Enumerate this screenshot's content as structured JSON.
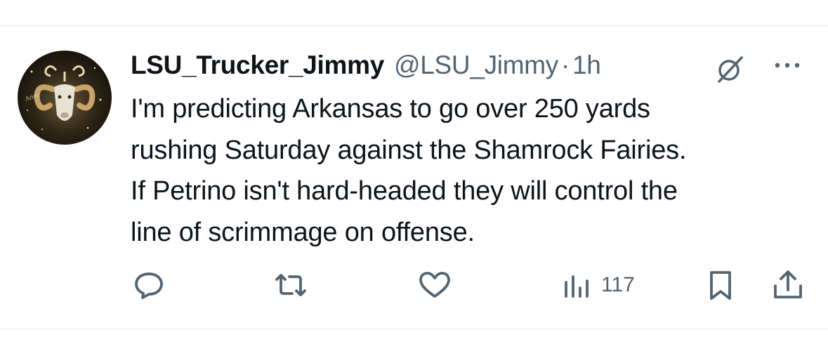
{
  "tweet": {
    "display_name": "LSU_Trucker_Jimmy",
    "handle": "@LSU_Jimmy",
    "separator": "·",
    "time": "1h",
    "avatar_icon": "aries-ram-avatar",
    "text_lines": [
      "I'm predicting Arkansas to go over 250 yards",
      "rushing Saturday against the Shamrock Fairies.",
      "If Petrino isn't hard-headed they will control the",
      "line of scrimmage on offense."
    ]
  },
  "actions": {
    "reply_icon": "reply-icon",
    "retweet_icon": "retweet-icon",
    "like_icon": "heart-icon",
    "views_icon": "views-bar-chart-icon",
    "views_count": "117",
    "bookmark_icon": "bookmark-icon",
    "share_icon": "share-icon"
  },
  "header_icons": {
    "grok": "grok-icon",
    "more": "more-icon"
  },
  "colors": {
    "text_primary": "#0f1419",
    "text_secondary": "#536471",
    "divider": "#e7e9ea"
  }
}
